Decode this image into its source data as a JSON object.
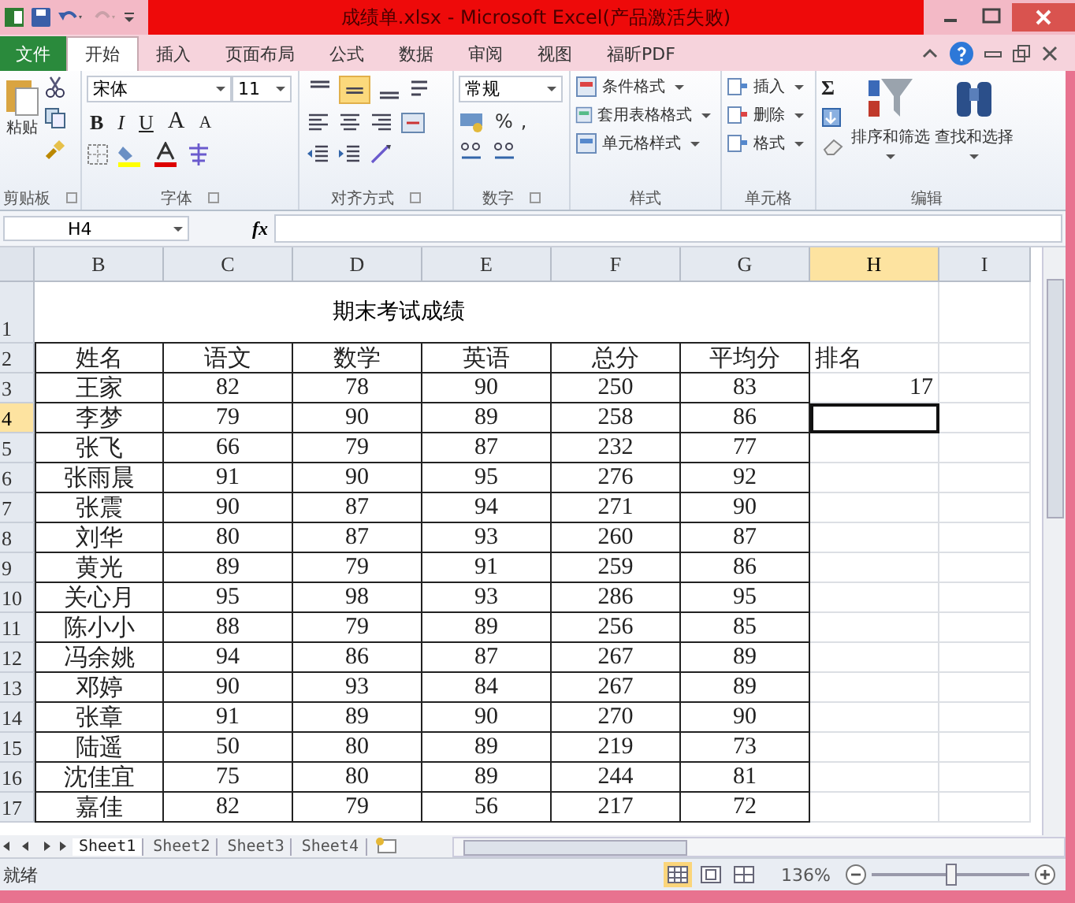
{
  "window": {
    "title": "成绩单.xlsx - Microsoft Excel(产品激活失败)"
  },
  "tabs": [
    {
      "label": "文件",
      "kind": "file",
      "selected": false
    },
    {
      "label": "开始",
      "kind": "tab",
      "selected": true
    },
    {
      "label": "插入",
      "kind": "tab",
      "selected": false
    },
    {
      "label": "页面布局",
      "kind": "tab",
      "selected": false
    },
    {
      "label": "公式",
      "kind": "tab",
      "selected": false
    },
    {
      "label": "数据",
      "kind": "tab",
      "selected": false
    },
    {
      "label": "审阅",
      "kind": "tab",
      "selected": false
    },
    {
      "label": "视图",
      "kind": "tab",
      "selected": false
    },
    {
      "label": "福昕PDF",
      "kind": "tab",
      "selected": false
    }
  ],
  "ribbon": {
    "clipboard": {
      "paste": "粘贴",
      "label": "剪贴板"
    },
    "font": {
      "name": "宋体",
      "size": "11",
      "format_buttons": [
        "B",
        "I",
        "U"
      ],
      "size_buttons": [
        "A",
        "A"
      ],
      "label": "字体"
    },
    "alignment": {
      "align_buttons": [
        {
          "kind": "top",
          "selected": false
        },
        {
          "kind": "middle",
          "selected": true
        },
        {
          "kind": "bottom",
          "selected": false
        }
      ],
      "label": "对齐方式"
    },
    "number": {
      "format": "常规",
      "percent": "%",
      "comma": ",",
      "label": "数字"
    },
    "styles": {
      "items": [
        "条件格式",
        "套用表格格式",
        "单元格样式"
      ],
      "label": "样式"
    },
    "cells": {
      "items": [
        "插入",
        "删除",
        "格式"
      ],
      "label": "单元格"
    },
    "editing": {
      "sum": "Σ",
      "buttons": [
        "排序和筛选",
        "查找和选择"
      ],
      "label": "编辑"
    }
  },
  "formula_bar": {
    "name_box": "H4",
    "fx": "fx"
  },
  "sheet": {
    "columns": [
      {
        "label": "B",
        "selected": false
      },
      {
        "label": "C",
        "selected": false
      },
      {
        "label": "D",
        "selected": false
      },
      {
        "label": "E",
        "selected": false
      },
      {
        "label": "F",
        "selected": false
      },
      {
        "label": "G",
        "selected": false
      },
      {
        "label": "H",
        "selected": true
      },
      {
        "label": "I",
        "selected": false
      }
    ],
    "rows": [
      {
        "label": "1",
        "selected": false
      },
      {
        "label": "2",
        "selected": false
      },
      {
        "label": "3",
        "selected": false
      },
      {
        "label": "4",
        "selected": true
      },
      {
        "label": "5",
        "selected": false
      },
      {
        "label": "6",
        "selected": false
      },
      {
        "label": "7",
        "selected": false
      },
      {
        "label": "8",
        "selected": false
      },
      {
        "label": "9",
        "selected": false
      },
      {
        "label": "10",
        "selected": false
      },
      {
        "label": "11",
        "selected": false
      },
      {
        "label": "12",
        "selected": false
      },
      {
        "label": "13",
        "selected": false
      },
      {
        "label": "14",
        "selected": false
      },
      {
        "label": "15",
        "selected": false
      },
      {
        "label": "16",
        "selected": false
      },
      {
        "label": "17",
        "selected": false
      }
    ],
    "title": "期末考试成绩",
    "table": {
      "columns": [
        "姓名",
        "语文",
        "数学",
        "英语",
        "总分",
        "平均分"
      ],
      "rows": [
        [
          "王家",
          "82",
          "78",
          "90",
          "250",
          "83"
        ],
        [
          "李梦",
          "79",
          "90",
          "89",
          "258",
          "86"
        ],
        [
          "张飞",
          "66",
          "79",
          "87",
          "232",
          "77"
        ],
        [
          "张雨晨",
          "91",
          "90",
          "95",
          "276",
          "92"
        ],
        [
          "张震",
          "90",
          "87",
          "94",
          "271",
          "90"
        ],
        [
          "刘华",
          "80",
          "87",
          "93",
          "260",
          "87"
        ],
        [
          "黄光",
          "89",
          "79",
          "91",
          "259",
          "86"
        ],
        [
          "关心月",
          "95",
          "98",
          "93",
          "286",
          "95"
        ],
        [
          "陈小小",
          "88",
          "79",
          "89",
          "256",
          "85"
        ],
        [
          "冯余姚",
          "94",
          "86",
          "87",
          "267",
          "89"
        ],
        [
          "邓婷",
          "90",
          "93",
          "84",
          "267",
          "89"
        ],
        [
          "张章",
          "91",
          "89",
          "90",
          "270",
          "90"
        ],
        [
          "陆遥",
          "50",
          "80",
          "89",
          "219",
          "73"
        ],
        [
          "沈佳宜",
          "75",
          "80",
          "89",
          "244",
          "81"
        ],
        [
          "嘉佳",
          "82",
          "79",
          "56",
          "217",
          "72"
        ]
      ]
    },
    "rank_header": "排名",
    "rank_values": [
      "17"
    ]
  },
  "sheet_tabs": [
    {
      "label": "Sheet1",
      "selected": true
    },
    {
      "label": "Sheet2",
      "selected": false
    },
    {
      "label": "Sheet3",
      "selected": false
    },
    {
      "label": "Sheet4",
      "selected": false
    }
  ],
  "status_bar": {
    "ready": "就绪",
    "views": [
      {
        "kind": "normal",
        "selected": true
      },
      {
        "kind": "layout",
        "selected": false
      },
      {
        "kind": "break",
        "selected": false
      }
    ],
    "zoom": "136%",
    "zoom_slider": {
      "level": 0.5
    }
  }
}
